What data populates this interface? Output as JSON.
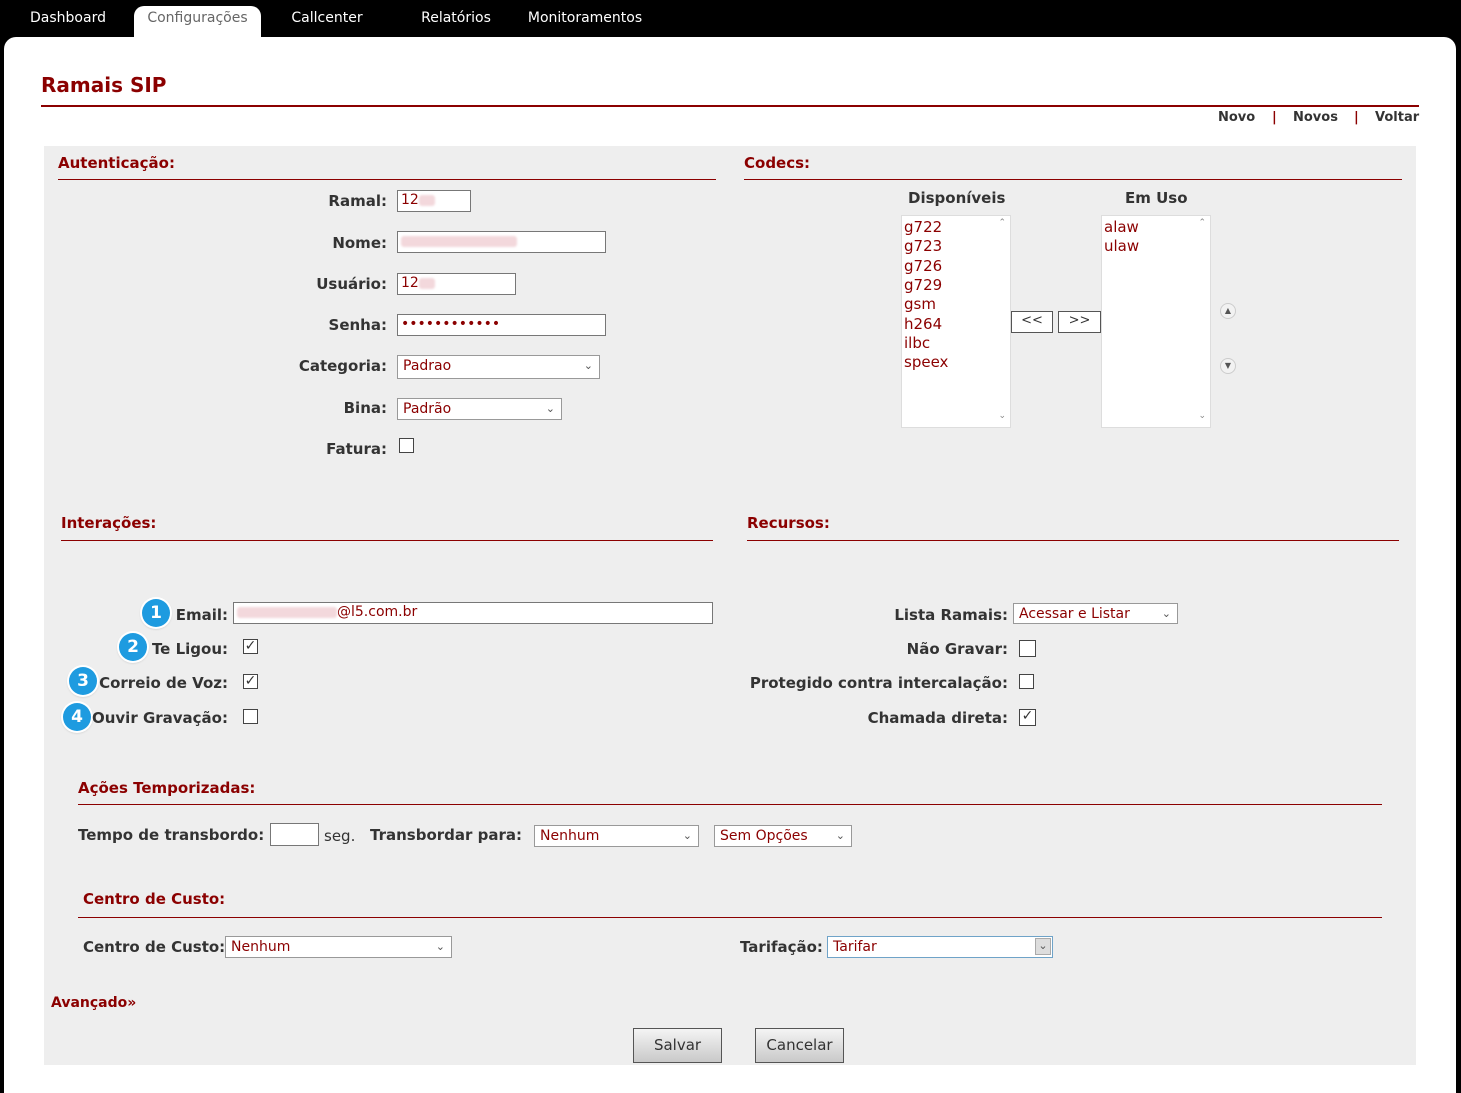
{
  "nav": {
    "tabs": [
      "Dashboard",
      "Configurações",
      "Callcenter",
      "Relatórios",
      "Monitoramentos"
    ],
    "active": "Configurações"
  },
  "page": {
    "title": "Ramais SIP",
    "actions": [
      "Novo",
      "Novos",
      "Voltar"
    ],
    "separator": "|"
  },
  "auth": {
    "heading": "Autenticação:",
    "ramal_label": "Ramal:",
    "ramal_value": "12",
    "nome_label": "Nome:",
    "usuario_label": "Usuário:",
    "usuario_value": "12",
    "senha_label": "Senha:",
    "senha_value": "••••••••••••",
    "categoria_label": "Categoria:",
    "categoria_value": "Padrao",
    "bina_label": "Bina:",
    "bina_value": "Padrão",
    "fatura_label": "Fatura:",
    "fatura_checked": false
  },
  "codecs": {
    "heading": "Codecs:",
    "available_label": "Disponíveis",
    "inuse_label": "Em Uso",
    "available": [
      "g722",
      "g723",
      "g726",
      "g729",
      "gsm",
      "h264",
      "ilbc",
      "speex"
    ],
    "in_use": [
      "alaw",
      "ulaw"
    ],
    "move_left": "<<",
    "move_right": ">>"
  },
  "interactions": {
    "heading": "Interações:",
    "email_label": "Email:",
    "email_suffix": "@l5.com.br",
    "te_ligou_label": "Te Ligou:",
    "te_ligou_checked": true,
    "correio_label": "Correio de Voz:",
    "correio_checked": true,
    "ouvir_label": "Ouvir Gravação:",
    "ouvir_checked": false,
    "badges": [
      "1",
      "2",
      "3",
      "4"
    ]
  },
  "resources": {
    "heading": "Recursos:",
    "lista_label": "Lista Ramais:",
    "lista_value": "Acessar e Listar",
    "nao_gravar_label": "Não Gravar:",
    "nao_gravar_checked": false,
    "protegido_label": "Protegido contra intercalação:",
    "protegido_checked": false,
    "chamada_label": "Chamada direta:",
    "chamada_checked": true
  },
  "timed": {
    "heading": "Ações Temporizadas:",
    "tempo_label": "Tempo de transbordo:",
    "tempo_value": "",
    "seg": "seg.",
    "transbordar_label": "Transbordar para:",
    "transbordar_value": "Nenhum",
    "opcoes_value": "Sem Opções"
  },
  "cost": {
    "heading": "Centro de Custo:",
    "centro_label": "Centro de Custo:",
    "centro_value": "Nenhum",
    "tarifacao_label": "Tarifação:",
    "tarifacao_value": "Tarifar"
  },
  "advanced": "Avançado»",
  "buttons": {
    "save": "Salvar",
    "cancel": "Cancelar"
  }
}
